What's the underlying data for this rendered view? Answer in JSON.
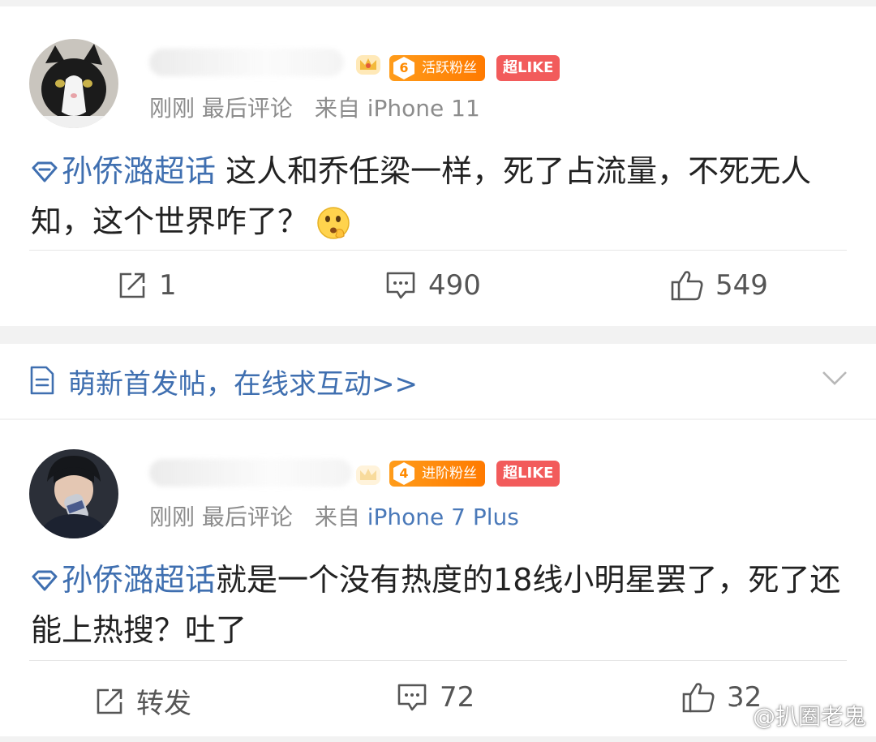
{
  "posts": [
    {
      "fan_badge": {
        "level": "6",
        "label": "活跃粉丝"
      },
      "like_badge": "超LIKE",
      "meta": {
        "time": "刚刚",
        "status": "最后评论",
        "source_prefix": "来自",
        "device": "iPhone 11"
      },
      "topic": "孙侨潞超话",
      "text": " 这人和乔任梁一样，死了占流量，不死无人知，这个世界咋了？",
      "emoji_icon": "thinking-face-emoji",
      "actions": {
        "repost": "1",
        "comments": "490",
        "likes": "549"
      }
    },
    {
      "fan_badge": {
        "level": "4",
        "label": "进阶粉丝"
      },
      "like_badge": "超LIKE",
      "meta": {
        "time": "刚刚",
        "status": "最后评论",
        "source_prefix": "来自",
        "device": "iPhone 7 Plus"
      },
      "topic": "孙侨潞超话",
      "text": "就是一个没有热度的18线小明星罢了，死了还能上热搜？吐了",
      "actions": {
        "repost": "转发",
        "comments": "72",
        "likes": "32"
      }
    }
  ],
  "banner": {
    "text": "萌新首发帖，在线求互动>>"
  },
  "watermark": {
    "text": "@扒圈老鬼"
  },
  "colors": {
    "link_blue": "#3f6fb0",
    "fan_orange": "#ff8a00",
    "like_red": "#f25b5b",
    "meta_gray": "#8c8c8c"
  }
}
